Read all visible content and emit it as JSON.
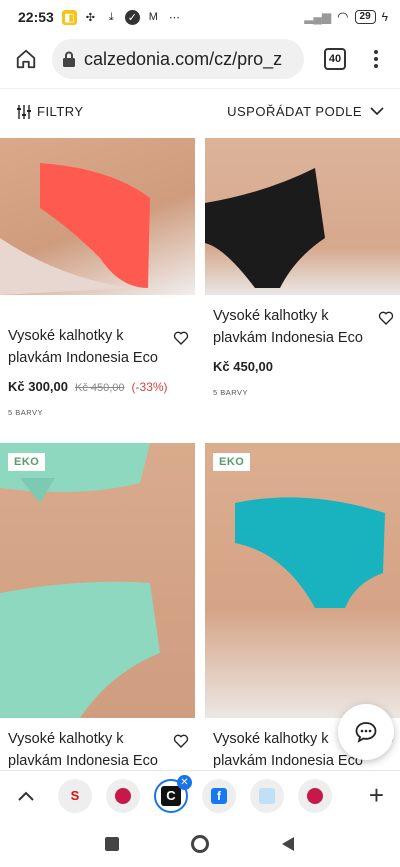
{
  "status": {
    "time": "22:53",
    "battery": "29"
  },
  "browser": {
    "url": "calzedonia.com/cz/pro_z",
    "tab_count": "40"
  },
  "filters": {
    "filter_label": "FILTRY",
    "sort_label": "USPOŘÁDAT PODLE"
  },
  "products": [
    {
      "title": "Vysoké kalhotky k plavkám Indonesia Eco",
      "price": "Kč 300,00",
      "old_price": "Kč 450,00",
      "discount": "(-33%)",
      "colors": "5 BARVY",
      "badge": "",
      "swatch": "#ff5a4f"
    },
    {
      "title": "Vysoké kalhotky k plavkám Indonesia Eco",
      "price": "Kč 450,00",
      "old_price": "",
      "discount": "",
      "colors": "5 BARVY",
      "badge": "",
      "swatch": "#1b1b1b"
    },
    {
      "title": "Vysoké kalhotky k plavkám Indonesia Eco",
      "badge": "EKO",
      "swatch": "#8fd8c0"
    },
    {
      "title": "Vysoké kalhotky k plavkám Indonesia Eco",
      "badge": "EKO",
      "swatch": "#19b3bf"
    }
  ],
  "tab_strip": {
    "active_letter": "C"
  }
}
